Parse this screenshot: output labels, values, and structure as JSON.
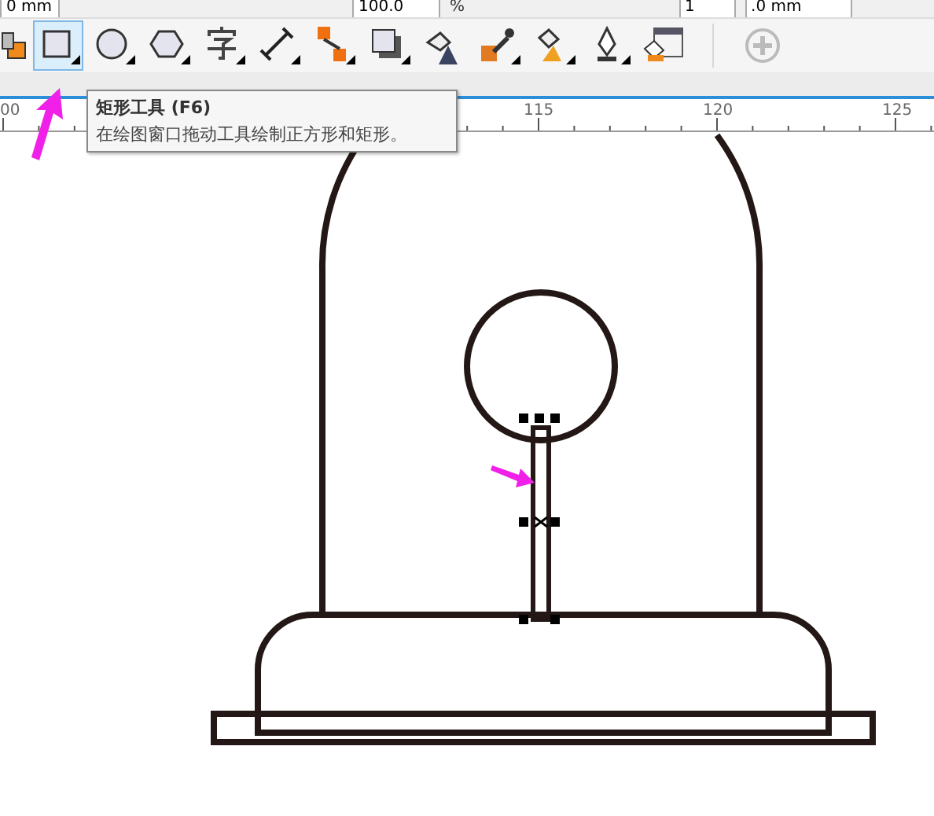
{
  "property_bar": {
    "fields": [
      {
        "value": "0 mm"
      },
      {
        "value": "100.0"
      },
      {
        "value": "1"
      },
      {
        "value": ".0 mm"
      }
    ],
    "unit": "%"
  },
  "toolbox": {
    "tools": [
      {
        "kind": "fill-partial",
        "selected": false
      },
      {
        "kind": "rectangle",
        "selected": true
      },
      {
        "kind": "ellipse",
        "selected": false
      },
      {
        "kind": "polygon",
        "selected": false
      },
      {
        "kind": "text",
        "selected": false
      },
      {
        "kind": "dimension",
        "selected": false
      },
      {
        "kind": "connector",
        "selected": false
      },
      {
        "kind": "shadow",
        "selected": false
      },
      {
        "kind": "transparency",
        "selected": false
      },
      {
        "kind": "eyedropper",
        "selected": false
      },
      {
        "kind": "bucket",
        "selected": false
      },
      {
        "kind": "pen",
        "selected": false
      },
      {
        "kind": "fill-dialog",
        "selected": false
      }
    ]
  },
  "tooltip": {
    "title": "矩形工具 (F6)",
    "description": "在绘图窗口拖动工具绘制正方形和矩形。"
  },
  "ruler": {
    "labels": [
      "00",
      "115",
      "120",
      "125"
    ]
  }
}
